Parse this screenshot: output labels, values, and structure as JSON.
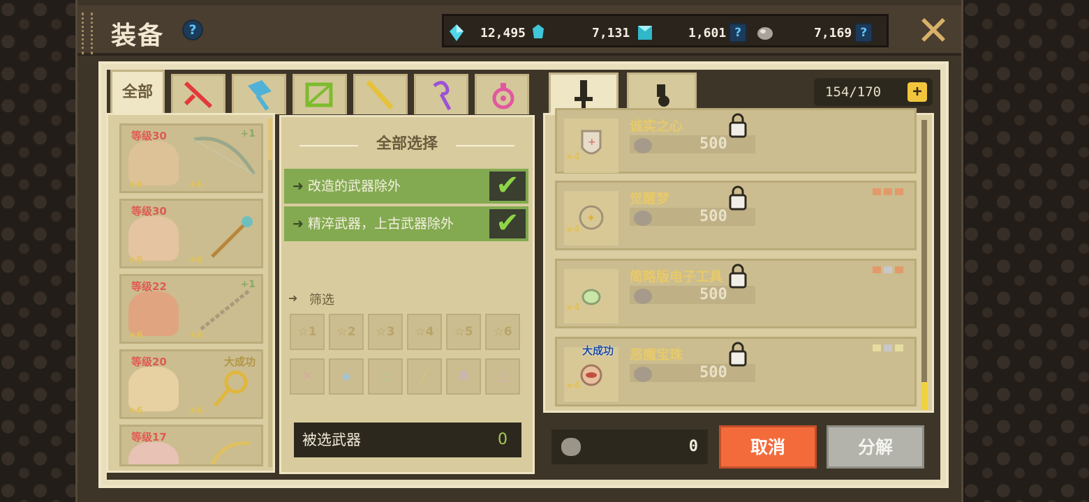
{
  "window": {
    "title": "装备"
  },
  "currencies": [
    {
      "name": "blue-crystal",
      "value": "12,495"
    },
    {
      "name": "cyan-gem",
      "value": "7,131"
    },
    {
      "name": "teal-cube",
      "value": "1,601"
    },
    {
      "name": "silver-ore",
      "value": "7,169"
    }
  ],
  "tabs": {
    "all_label": "全部",
    "icons": [
      "sword-icon",
      "hammer-icon",
      "bow-icon",
      "gun-icon",
      "staff-icon",
      "orb-icon"
    ]
  },
  "equipment_list": [
    {
      "level": "等级30",
      "badge": "+1",
      "star_left": "6",
      "star_right": "6"
    },
    {
      "level": "等级30",
      "badge": "",
      "star_left": "6",
      "star_right": "6"
    },
    {
      "level": "等级22",
      "badge": "+1",
      "star_left": "6",
      "star_right": "6"
    },
    {
      "level": "等级20",
      "badge": "大成功",
      "star_left": "6",
      "star_right": "6"
    },
    {
      "level": "等级17",
      "badge": "",
      "star_left": "",
      "star_right": ""
    }
  ],
  "select_panel": {
    "title": "全部选择",
    "options": [
      {
        "label": "改造的武器除外",
        "checked": true
      },
      {
        "label": "精淬武器，上古武器除外",
        "checked": true
      }
    ],
    "filter_label": "筛选",
    "star_filters": [
      "1",
      "2",
      "3",
      "4",
      "5",
      "6"
    ],
    "selected_label": "被选武器",
    "selected_count": "0"
  },
  "inventory": {
    "capacity": "154/170",
    "add_label": "+",
    "items": [
      {
        "name": "诚实之心",
        "star": "4",
        "price": "500",
        "badge": ""
      },
      {
        "name": "觉醒梦",
        "star": "4",
        "price": "500",
        "badge": ""
      },
      {
        "name": "简略版电子工具",
        "star": "4",
        "price": "500",
        "badge": ""
      },
      {
        "name": "恶魔宝珠",
        "star": "4",
        "price": "500",
        "badge": "大成功"
      }
    ]
  },
  "bottom": {
    "ore_value": "0",
    "cancel_label": "取消",
    "decompose_label": "分解"
  },
  "colors": {
    "accent_green": "#83aa51",
    "cancel_orange": "#f46b3b",
    "panel_cream": "#d9cda1"
  }
}
